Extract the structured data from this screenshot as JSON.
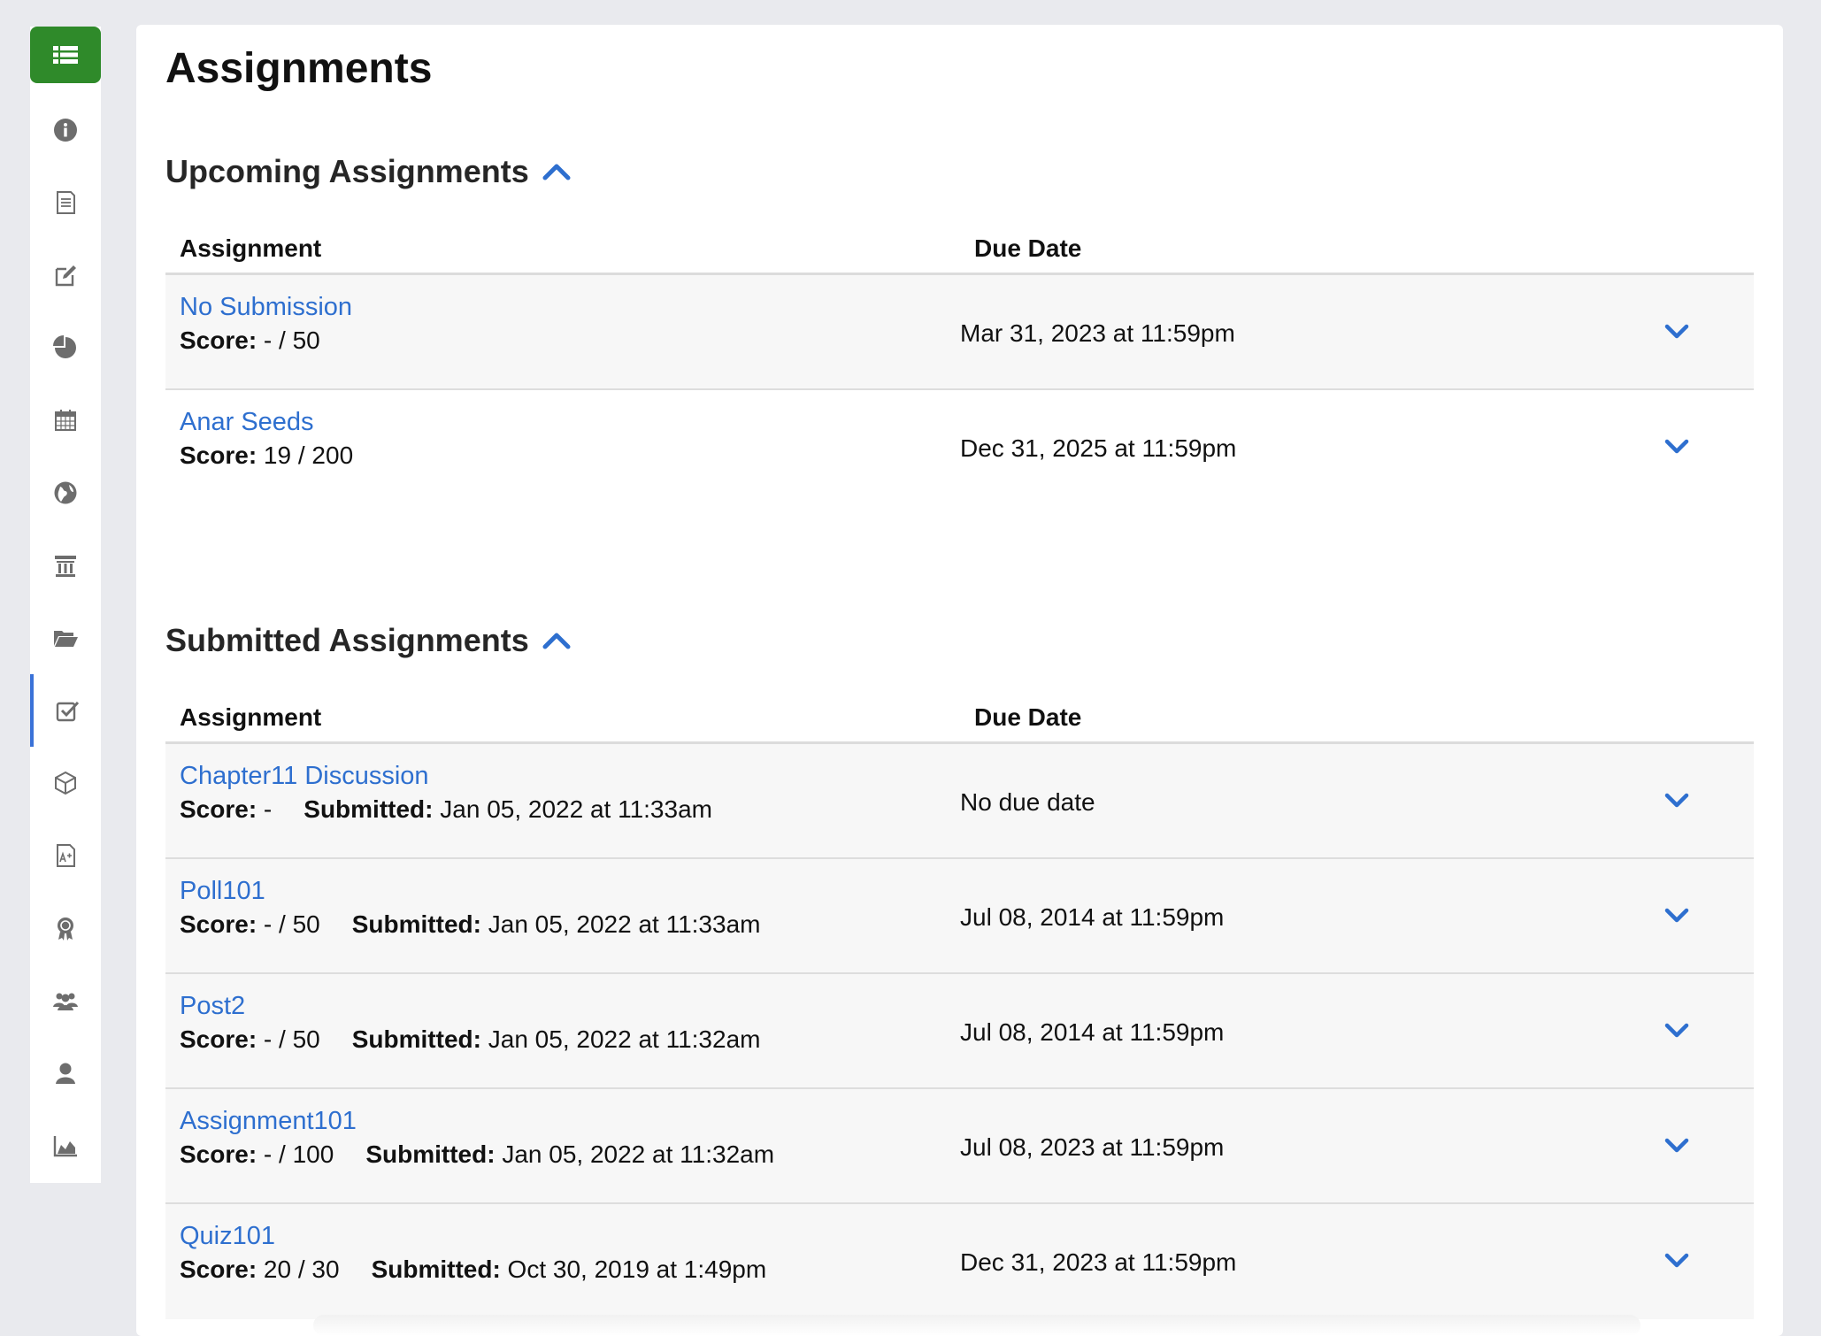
{
  "sidebar": {
    "accent_color": "#2f8a2a",
    "active_color": "#3a72d8",
    "top_icon": "list-icon",
    "items": [
      {
        "icon": "info-icon"
      },
      {
        "icon": "document-icon"
      },
      {
        "icon": "edit-icon"
      },
      {
        "icon": "pie-chart-icon"
      },
      {
        "icon": "calendar-icon"
      },
      {
        "icon": "globe-icon"
      },
      {
        "icon": "library-icon"
      },
      {
        "icon": "folder-open-icon"
      },
      {
        "icon": "checkbox-icon",
        "active": true
      },
      {
        "icon": "cube-icon"
      },
      {
        "icon": "grade-document-icon"
      },
      {
        "icon": "award-icon"
      },
      {
        "icon": "users-icon"
      },
      {
        "icon": "user-icon"
      },
      {
        "icon": "area-chart-icon"
      }
    ]
  },
  "page": {
    "title": "Assignments"
  },
  "upcoming": {
    "title": "Upcoming Assignments",
    "col_assignment": "Assignment",
    "col_due": "Due Date",
    "rows": [
      {
        "name": "No Submission",
        "score_label": "Score:",
        "score": " - / 50",
        "due": "Mar 31, 2023 at 11:59pm"
      },
      {
        "name": "Anar Seeds",
        "score_label": "Score:",
        "score": " 19 / 200",
        "due": "Dec 31, 2025 at 11:59pm"
      }
    ]
  },
  "submitted": {
    "title": "Submitted Assignments",
    "col_assignment": "Assignment",
    "col_due": "Due Date",
    "rows": [
      {
        "name": "Chapter11 Discussion",
        "score_label": "Score:",
        "score": " -",
        "submitted_label": "Submitted:",
        "submitted": " Jan 05, 2022 at 11:33am",
        "due": "No due date"
      },
      {
        "name": "Poll101",
        "score_label": "Score:",
        "score": " - / 50",
        "submitted_label": "Submitted:",
        "submitted": " Jan 05, 2022 at 11:33am",
        "due": "Jul 08, 2014 at 11:59pm"
      },
      {
        "name": "Post2",
        "score_label": "Score:",
        "score": " - / 50",
        "submitted_label": "Submitted:",
        "submitted": " Jan 05, 2022 at 11:32am",
        "due": "Jul 08, 2014 at 11:59pm"
      },
      {
        "name": "Assignment101",
        "score_label": "Score:",
        "score": " - / 100",
        "submitted_label": "Submitted:",
        "submitted": " Jan 05, 2022 at 11:32am",
        "due": "Jul 08, 2023 at 11:59pm"
      },
      {
        "name": "Quiz101",
        "score_label": "Score:",
        "score": " 20 / 30",
        "submitted_label": "Submitted:",
        "submitted": " Oct 30, 2019 at 1:49pm",
        "due": "Dec 31, 2023 at 11:59pm"
      }
    ]
  },
  "colors": {
    "link": "#2e6fcf",
    "chevron": "#2e6fcf",
    "row_bg": "#f7f7f7"
  }
}
